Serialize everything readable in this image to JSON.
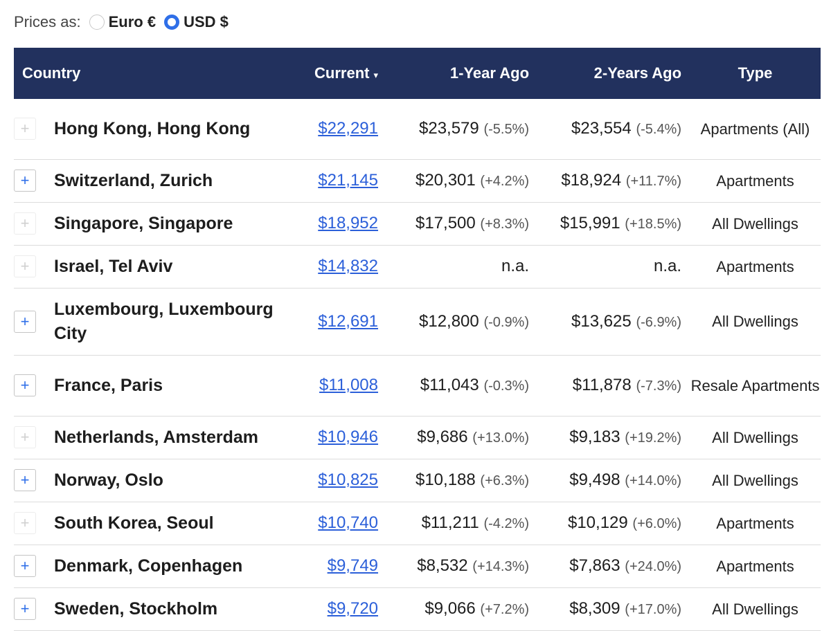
{
  "currency": {
    "label": "Prices as:",
    "options": [
      {
        "label": "Euro €",
        "selected": false
      },
      {
        "label": "USD $",
        "selected": true
      }
    ]
  },
  "table": {
    "headers": {
      "country": "Country",
      "current": "Current",
      "current_sort_indicator": "▾",
      "year1": "1-Year Ago",
      "year2": "2-Years Ago",
      "type": "Type"
    },
    "rows": [
      {
        "expandable": false,
        "country": "Hong Kong, Hong Kong",
        "current": "$22,291",
        "year1": "$23,579",
        "year1_change": "(-5.5%)",
        "year2": "$23,554",
        "year2_change": "(-5.4%)",
        "type": "Apartments (All)"
      },
      {
        "expandable": true,
        "country": "Switzerland, Zurich",
        "current": "$21,145",
        "year1": "$20,301",
        "year1_change": "(+4.2%)",
        "year2": "$18,924",
        "year2_change": "(+11.7%)",
        "type": "Apartments"
      },
      {
        "expandable": false,
        "country": "Singapore, Singapore",
        "current": "$18,952",
        "year1": "$17,500",
        "year1_change": "(+8.3%)",
        "year2": "$15,991",
        "year2_change": "(+18.5%)",
        "type": "All Dwellings"
      },
      {
        "expandable": false,
        "country": "Israel, Tel Aviv",
        "current": "$14,832",
        "year1": "n.a.",
        "year1_change": "",
        "year2": "n.a.",
        "year2_change": "",
        "type": "Apartments"
      },
      {
        "expandable": true,
        "country": "Luxembourg, Luxembourg City",
        "current": "$12,691",
        "year1": "$12,800",
        "year1_change": "(-0.9%)",
        "year2": "$13,625",
        "year2_change": "(-6.9%)",
        "type": "All Dwellings"
      },
      {
        "expandable": true,
        "country": "France, Paris",
        "current": "$11,008",
        "year1": "$11,043",
        "year1_change": "(-0.3%)",
        "year2": "$11,878",
        "year2_change": "(-7.3%)",
        "type": "Resale Apartments"
      },
      {
        "expandable": false,
        "country": "Netherlands, Amsterdam",
        "current": "$10,946",
        "year1": "$9,686",
        "year1_change": "(+13.0%)",
        "year2": "$9,183",
        "year2_change": "(+19.2%)",
        "type": "All Dwellings"
      },
      {
        "expandable": true,
        "country": "Norway, Oslo",
        "current": "$10,825",
        "year1": "$10,188",
        "year1_change": "(+6.3%)",
        "year2": "$9,498",
        "year2_change": "(+14.0%)",
        "type": "All Dwellings"
      },
      {
        "expandable": false,
        "country": "South Korea, Seoul",
        "current": "$10,740",
        "year1": "$11,211",
        "year1_change": "(-4.2%)",
        "year2": "$10,129",
        "year2_change": "(+6.0%)",
        "type": "Apartments"
      },
      {
        "expandable": true,
        "country": "Denmark, Copenhagen",
        "current": "$9,749",
        "year1": "$8,532",
        "year1_change": "(+14.3%)",
        "year2": "$7,863",
        "year2_change": "(+24.0%)",
        "type": "Apartments"
      },
      {
        "expandable": true,
        "country": "Sweden, Stockholm",
        "current": "$9,720",
        "year1": "$9,066",
        "year1_change": "(+7.2%)",
        "year2": "$8,309",
        "year2_change": "(+17.0%)",
        "type": "All Dwellings"
      }
    ]
  },
  "colors": {
    "header_bg": "#22315e",
    "link": "#2b5fd9",
    "radio_selected": "#2f6fe8"
  }
}
